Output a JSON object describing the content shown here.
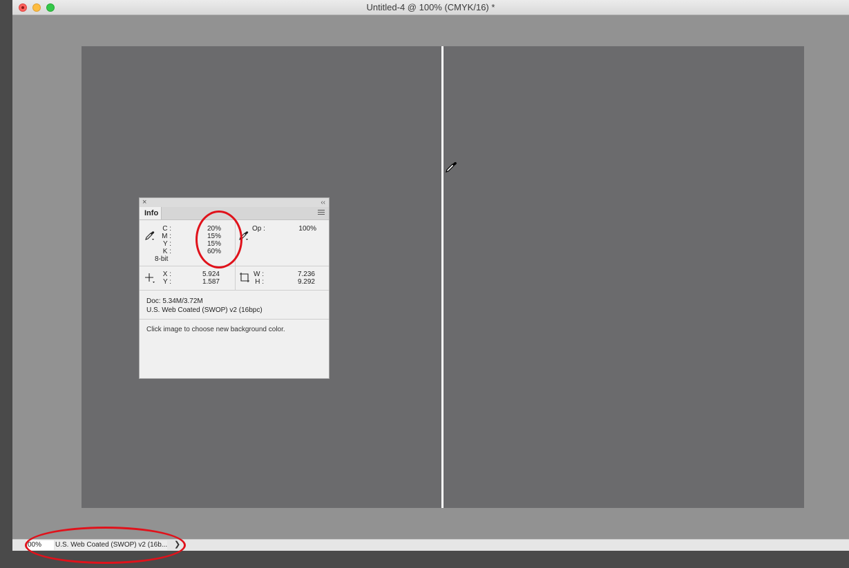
{
  "window": {
    "title": "Untitled-4 @ 100% (CMYK/16) *"
  },
  "info_panel": {
    "tab_label": "Info",
    "close_glyph": "×",
    "collapse_glyph": "‹‹",
    "color": {
      "labels": {
        "c": "C :",
        "m": "M :",
        "y": "Y :",
        "k": "K :"
      },
      "values": {
        "c": "20%",
        "m": "15%",
        "y": "15%",
        "k": "60%"
      },
      "bit_depth": "8-bit"
    },
    "opacity": {
      "label": "Op :",
      "value": "100%"
    },
    "position": {
      "x_label": "X :",
      "x_value": "5.924",
      "y_label": "Y :",
      "y_value": "1.587"
    },
    "size": {
      "w_label": "W :",
      "w_value": "7.236",
      "h_label": "H :",
      "h_value": "9.292"
    },
    "doc_size": "Doc: 5.34M/3.72M",
    "profile": "U.S. Web Coated (SWOP) v2 (16bpc)",
    "hint": "Click image to choose new background color."
  },
  "status_bar": {
    "zoom": "00%",
    "doc_info": "U.S. Web Coated (SWOP) v2 (16b...",
    "arrow_glyph": "❯"
  },
  "colors": {
    "canvas": "#6b6b6d",
    "pasteboard": "#929292",
    "annotation": "#e0121b",
    "guide": "#ffffff"
  },
  "icons": {
    "eyedropper": "eyedropper-icon",
    "crosshair": "crosshair-icon",
    "selection": "selection-size-icon",
    "menu": "panel-menu-icon"
  }
}
